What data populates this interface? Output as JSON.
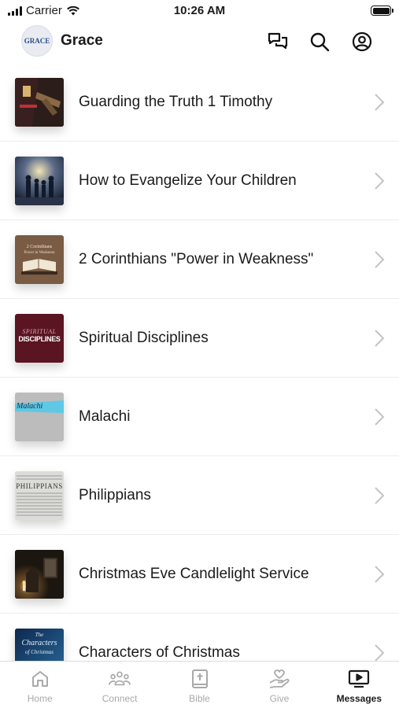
{
  "status_bar": {
    "carrier": "Carrier",
    "time": "10:26 AM"
  },
  "header": {
    "title": "Grace",
    "avatar_text": "GRACE"
  },
  "messages": [
    {
      "title": "Guarding the Truth 1 Timothy"
    },
    {
      "title": "How to Evangelize Your Children"
    },
    {
      "title": "2 Corinthians \"Power in Weakness\"",
      "thumb_text_1": "2 Corinthians",
      "thumb_text_2": "Power in Weakness"
    },
    {
      "title": "Spiritual Disciplines",
      "thumb_text_1": "SPIRITUAL",
      "thumb_text_2": "DISCIPLINES"
    },
    {
      "title": "Malachi",
      "thumb_text": "Malachi"
    },
    {
      "title": "Philippians",
      "thumb_text": "PHILIPPIANS"
    },
    {
      "title": "Christmas Eve Candlelight Service"
    },
    {
      "title": "Characters of Christmas",
      "thumb_text_1": "The",
      "thumb_text_2": "Characters",
      "thumb_text_3": "of Christmas"
    }
  ],
  "tabs": [
    {
      "label": "Home",
      "icon": "home-icon",
      "active": false
    },
    {
      "label": "Connect",
      "icon": "people-icon",
      "active": false
    },
    {
      "label": "Bible",
      "icon": "bible-icon",
      "active": false
    },
    {
      "label": "Give",
      "icon": "give-icon",
      "active": false
    },
    {
      "label": "Messages",
      "icon": "play-screen-icon",
      "active": true
    }
  ],
  "colors": {
    "text": "#1b1b1b",
    "inactive": "#a9a9a9",
    "divider": "#ececec"
  }
}
